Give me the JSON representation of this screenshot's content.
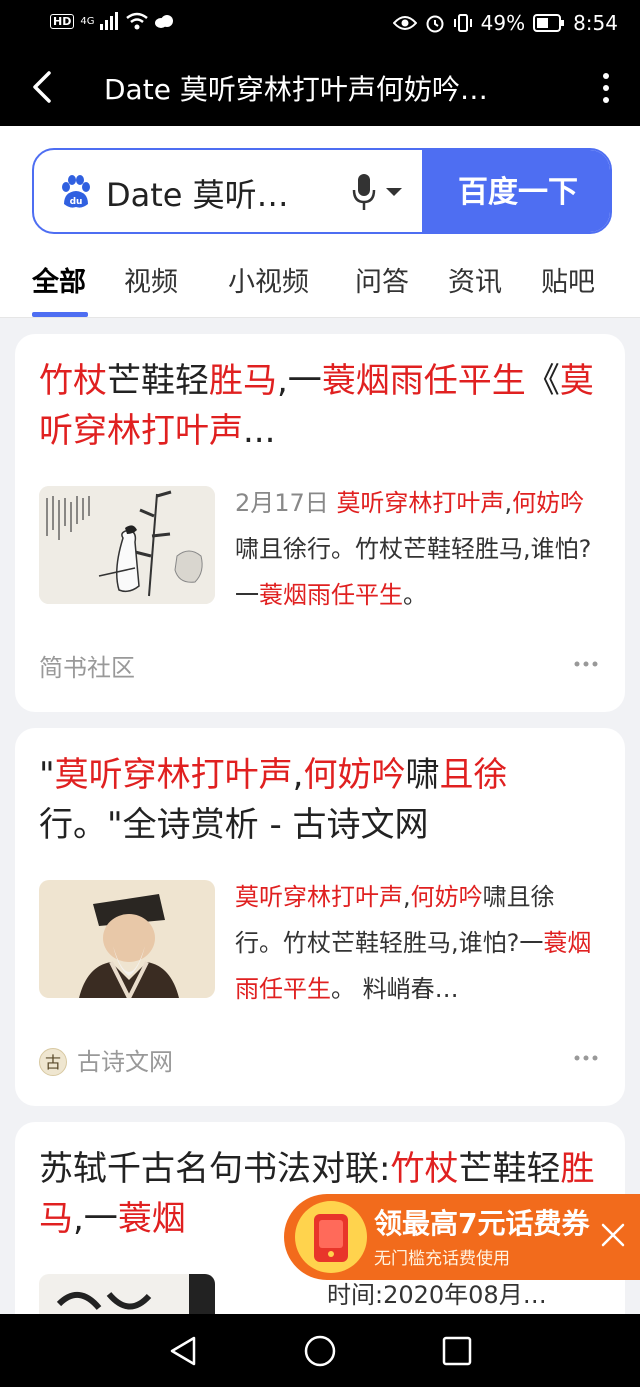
{
  "status_bar": {
    "hd": "HD",
    "network": "4G",
    "battery": "49%",
    "time": "8:54"
  },
  "title_bar": {
    "title": "Date 莫听穿林打叶声何妨吟…"
  },
  "search": {
    "query": "Date 莫听…",
    "button_label": "百度一下"
  },
  "tabs": [
    "全部",
    "视频",
    "小视频",
    "问答",
    "资讯",
    "贴吧"
  ],
  "results": [
    {
      "title_parts": [
        {
          "t": "竹杖",
          "h": true
        },
        {
          "t": "芒鞋轻",
          "h": false
        },
        {
          "t": "胜马",
          "h": true
        },
        {
          "t": ",一",
          "h": false
        },
        {
          "t": "蓑烟雨任平生",
          "h": true
        },
        {
          "t": "《",
          "h": false
        },
        {
          "t": "莫听穿林打叶声",
          "h": true
        },
        {
          "t": "...",
          "h": false
        }
      ],
      "snippet_parts": [
        {
          "t": "2月17日 ",
          "h": false,
          "date": true
        },
        {
          "t": "莫听穿林打叶声",
          "h": true
        },
        {
          "t": ",",
          "h": false
        },
        {
          "t": "何妨吟",
          "h": true
        },
        {
          "t": "啸且徐行。竹杖芒鞋轻胜马,谁怕?一",
          "h": false
        },
        {
          "t": "蓑烟雨任平生",
          "h": true
        },
        {
          "t": "。",
          "h": false
        }
      ],
      "source": "简书社区"
    },
    {
      "title_parts": [
        {
          "t": "\"",
          "h": false
        },
        {
          "t": "莫听穿林打叶声",
          "h": true
        },
        {
          "t": ",",
          "h": false
        },
        {
          "t": "何妨吟",
          "h": true
        },
        {
          "t": "啸",
          "h": false
        },
        {
          "t": "且徐",
          "h": true
        },
        {
          "t": "行。\"全诗赏析 - 古诗文网",
          "h": false
        }
      ],
      "snippet_parts": [
        {
          "t": "莫听穿林打叶声",
          "h": true
        },
        {
          "t": ",",
          "h": false
        },
        {
          "t": "何妨吟",
          "h": true
        },
        {
          "t": "啸且徐行。竹杖芒鞋轻胜马,谁怕?一",
          "h": false
        },
        {
          "t": "蓑烟雨任平生",
          "h": true
        },
        {
          "t": "。 料峭春…",
          "h": false
        }
      ],
      "source_icon": "古",
      "source": "古诗文网"
    },
    {
      "title_parts": [
        {
          "t": "苏轼千古名句书法对联:",
          "h": false
        },
        {
          "t": "竹杖",
          "h": true
        },
        {
          "t": "芒鞋轻",
          "h": false
        },
        {
          "t": "胜马",
          "h": true
        },
        {
          "t": ",一",
          "h": false
        },
        {
          "t": "蓑烟",
          "h": true
        }
      ],
      "snippet": "时间:2020年08月…"
    }
  ],
  "promo": {
    "title": "领最高7元话费券",
    "subtitle": "无门槛充话费使用"
  },
  "colors": {
    "accent": "#4e6ef2",
    "highlight": "#e02020",
    "promo": "#f26b1c"
  }
}
